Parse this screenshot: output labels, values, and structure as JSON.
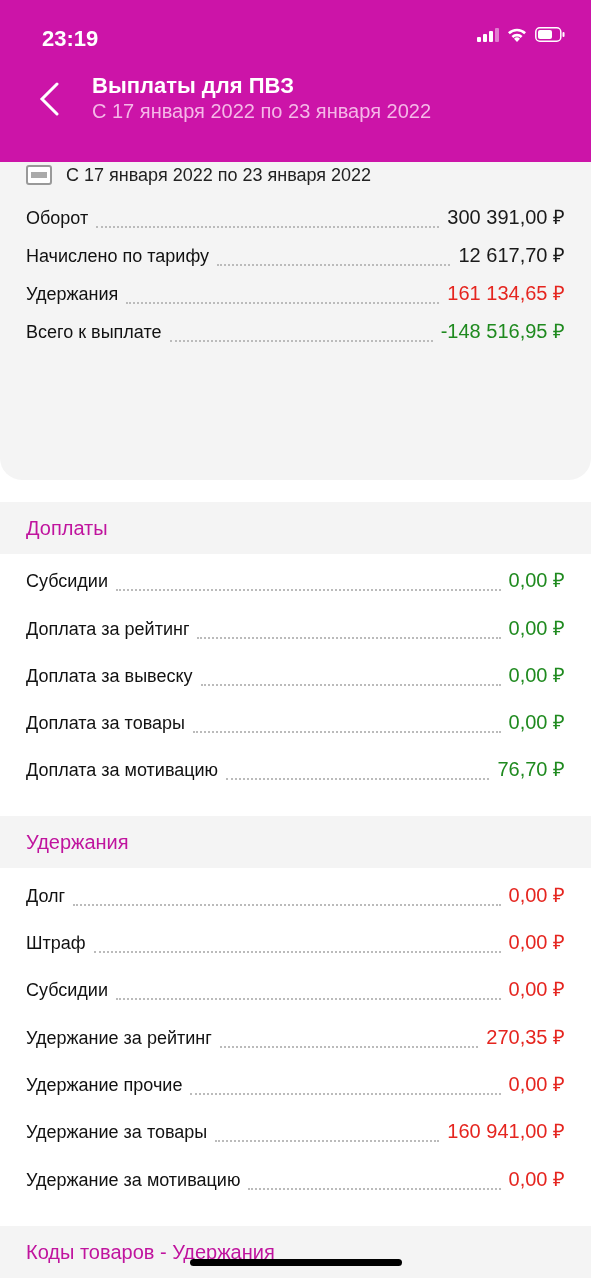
{
  "status_bar": {
    "time": "23:19"
  },
  "header": {
    "title": "Выплаты для ПВЗ",
    "subtitle": "С 17 января 2022 по 23 января 2022"
  },
  "summary": {
    "period": "С 17 января 2022 по 23 января 2022",
    "rows": [
      {
        "label": "Оборот",
        "value": "300 391,00 ₽",
        "color": "#1a1a1a"
      },
      {
        "label": "Начислено по тарифу",
        "value": "12 617,70 ₽",
        "color": "#1a1a1a"
      },
      {
        "label": "Удержания",
        "value": "161 134,65 ₽",
        "color": "#e5251f"
      },
      {
        "label": "Всего к выплате",
        "value": "-148 516,95 ₽",
        "color": "#1f8a1f"
      }
    ]
  },
  "sections": [
    {
      "title": "Доплаты",
      "rows": [
        {
          "label": "Субсидии",
          "value": "0,00 ₽",
          "color": "#1f8a1f"
        },
        {
          "label": "Доплата за рейтинг",
          "value": "0,00 ₽",
          "color": "#1f8a1f"
        },
        {
          "label": "Доплата за вывеску",
          "value": "0,00 ₽",
          "color": "#1f8a1f"
        },
        {
          "label": "Доплата за товары",
          "value": "0,00 ₽",
          "color": "#1f8a1f"
        },
        {
          "label": "Доплата за мотивацию",
          "value": "76,70 ₽",
          "color": "#1f8a1f"
        }
      ]
    },
    {
      "title": "Удержания",
      "rows": [
        {
          "label": "Долг",
          "value": "0,00 ₽",
          "color": "#e5251f"
        },
        {
          "label": "Штраф",
          "value": "0,00 ₽",
          "color": "#e5251f"
        },
        {
          "label": "Субсидии",
          "value": "0,00 ₽",
          "color": "#e5251f"
        },
        {
          "label": "Удержание за рейтинг",
          "value": "270,35 ₽",
          "color": "#e5251f"
        },
        {
          "label": "Удержание прочие",
          "value": "0,00 ₽",
          "color": "#e5251f"
        },
        {
          "label": "Удержание за товары",
          "value": "160 941,00 ₽",
          "color": "#e5251f"
        },
        {
          "label": "Удержание за мотивацию",
          "value": "0,00 ₽",
          "color": "#e5251f"
        }
      ]
    },
    {
      "title": "Коды товаров - Удержания"
    }
  ]
}
